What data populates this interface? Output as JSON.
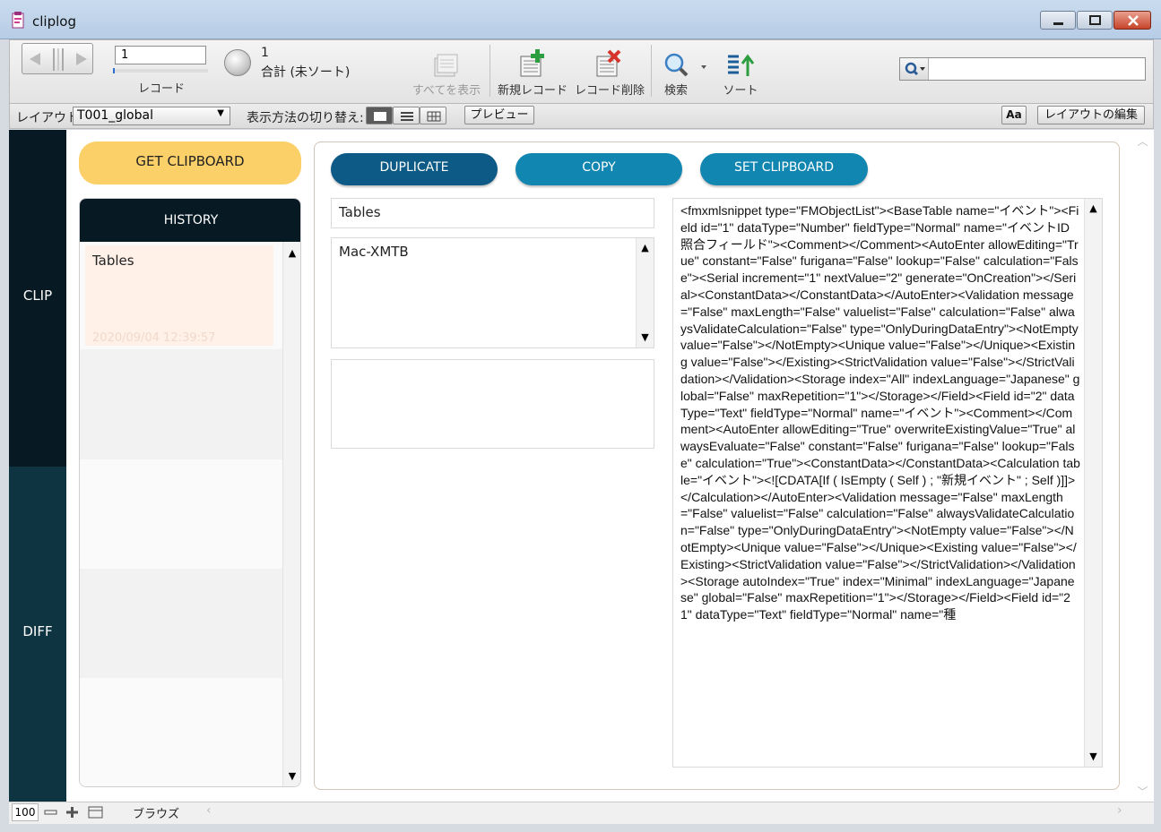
{
  "window": {
    "title": "cliplog"
  },
  "toolbar": {
    "record_number": "1",
    "record_label": "レコード",
    "total_count": "1",
    "total_label": "合計 (未ソート)",
    "show_all": "すべてを表示",
    "new_record": "新規レコード",
    "delete_record": "レコード削除",
    "find": "検索",
    "sort": "ソート",
    "search_placeholder": ""
  },
  "layout_bar": {
    "layout_label": "レイアウト:",
    "layout_value": "T001_global",
    "view_label": "表示方法の切り替え:",
    "preview": "プレビュー",
    "aa": "Aa",
    "edit_layout": "レイアウトの編集"
  },
  "sidebar": {
    "clip": "CLIP",
    "diff": "DIFF"
  },
  "left_panel": {
    "get_clipboard": "GET CLIPBOARD",
    "history_title": "HISTORY",
    "history_items": [
      {
        "title": "Tables",
        "timestamp": "2020/09/04 12:39:57"
      }
    ]
  },
  "actions": {
    "duplicate": "DUPLICATE",
    "copy": "COPY",
    "set_clipboard": "SET CLIPBOARD"
  },
  "detail": {
    "name": "Tables",
    "source": "Mac-XMTB",
    "note": "",
    "xml": "<fmxmlsnippet type=\"FMObjectList\"><BaseTable name=\"イベント\"><Field id=\"1\" dataType=\"Number\" fieldType=\"Normal\" name=\"イベントID照合フィールド\"><Comment></Comment><AutoEnter allowEditing=\"True\" constant=\"False\" furigana=\"False\" lookup=\"False\" calculation=\"False\"><Serial increment=\"1\" nextValue=\"2\" generate=\"OnCreation\"></Serial><ConstantData></ConstantData></AutoEnter><Validation message=\"False\" maxLength=\"False\" valuelist=\"False\" calculation=\"False\" alwaysValidateCalculation=\"False\" type=\"OnlyDuringDataEntry\"><NotEmpty value=\"False\"></NotEmpty><Unique value=\"False\"></Unique><Existing value=\"False\"></Existing><StrictValidation value=\"False\"></StrictValidation></Validation><Storage index=\"All\" indexLanguage=\"Japanese\" global=\"False\" maxRepetition=\"1\"></Storage></Field><Field id=\"2\" dataType=\"Text\" fieldType=\"Normal\" name=\"イベント\"><Comment></Comment><AutoEnter allowEditing=\"True\" overwriteExistingValue=\"True\" alwaysEvaluate=\"False\" constant=\"False\" furigana=\"False\" lookup=\"False\" calculation=\"True\"><ConstantData></ConstantData><Calculation table=\"イベント\"><![CDATA[If ( IsEmpty ( Self ) ; \"新規イベント\" ; Self )]]></Calculation></AutoEnter><Validation message=\"False\" maxLength=\"False\" valuelist=\"False\" calculation=\"False\" alwaysValidateCalculation=\"False\" type=\"OnlyDuringDataEntry\"><NotEmpty value=\"False\"></NotEmpty><Unique value=\"False\"></Unique><Existing value=\"False\"></Existing><StrictValidation value=\"False\"></StrictValidation></Validation><Storage autoIndex=\"True\" index=\"Minimal\" indexLanguage=\"Japanese\" global=\"False\" maxRepetition=\"1\"></Storage></Field><Field id=\"21\" dataType=\"Text\" fieldType=\"Normal\" name=\"種"
  },
  "statusbar": {
    "zoom": "100",
    "mode": "ブラウズ"
  },
  "colors": {
    "accent_yellow": "#fcd068",
    "dark_navy": "#071a24",
    "teal": "#0e3442",
    "button_blue": "#1186b1",
    "button_dark": "#0c5a85",
    "history_item_bg": "#fff1e7"
  }
}
